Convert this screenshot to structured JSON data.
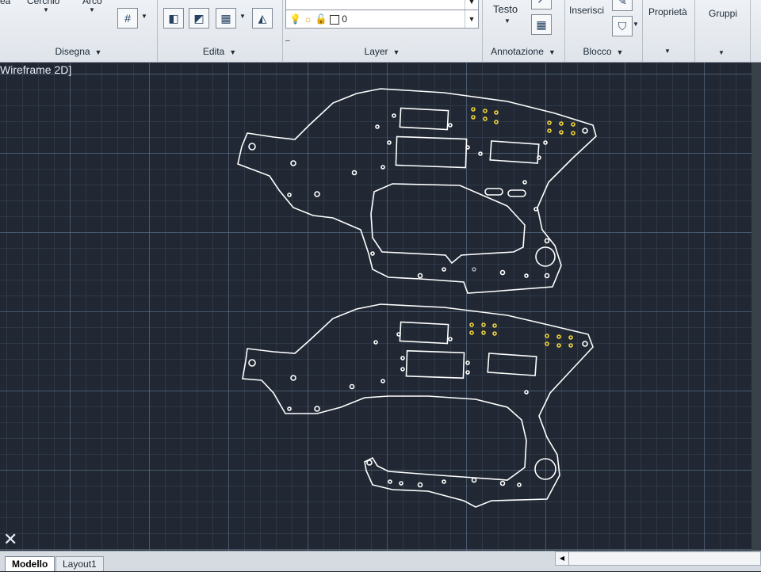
{
  "ribbon": {
    "disegna": {
      "title": "Disegna",
      "cerchio": "Cerchio",
      "arco": "Arco",
      "linea": "ea"
    },
    "edita": {
      "title": "Edita"
    },
    "layer": {
      "title": "Layer",
      "current_layer": "0"
    },
    "annotazione": {
      "title": "Annotazione",
      "testo": "Testo"
    },
    "blocco": {
      "title": "Blocco",
      "inserisci": "Inserisci"
    },
    "proprieta": {
      "title": "Proprietà"
    },
    "gruppi": {
      "title": "Gruppi"
    }
  },
  "viewport": {
    "label": "Wireframe 2D]"
  },
  "tabs": {
    "model": "Modello",
    "layout1": "Layout1"
  },
  "colors": {
    "background": "#212833",
    "outline": "#ffffff",
    "holes_yellow": "#f2d43a",
    "hole_gray": "#9aa4b0"
  }
}
